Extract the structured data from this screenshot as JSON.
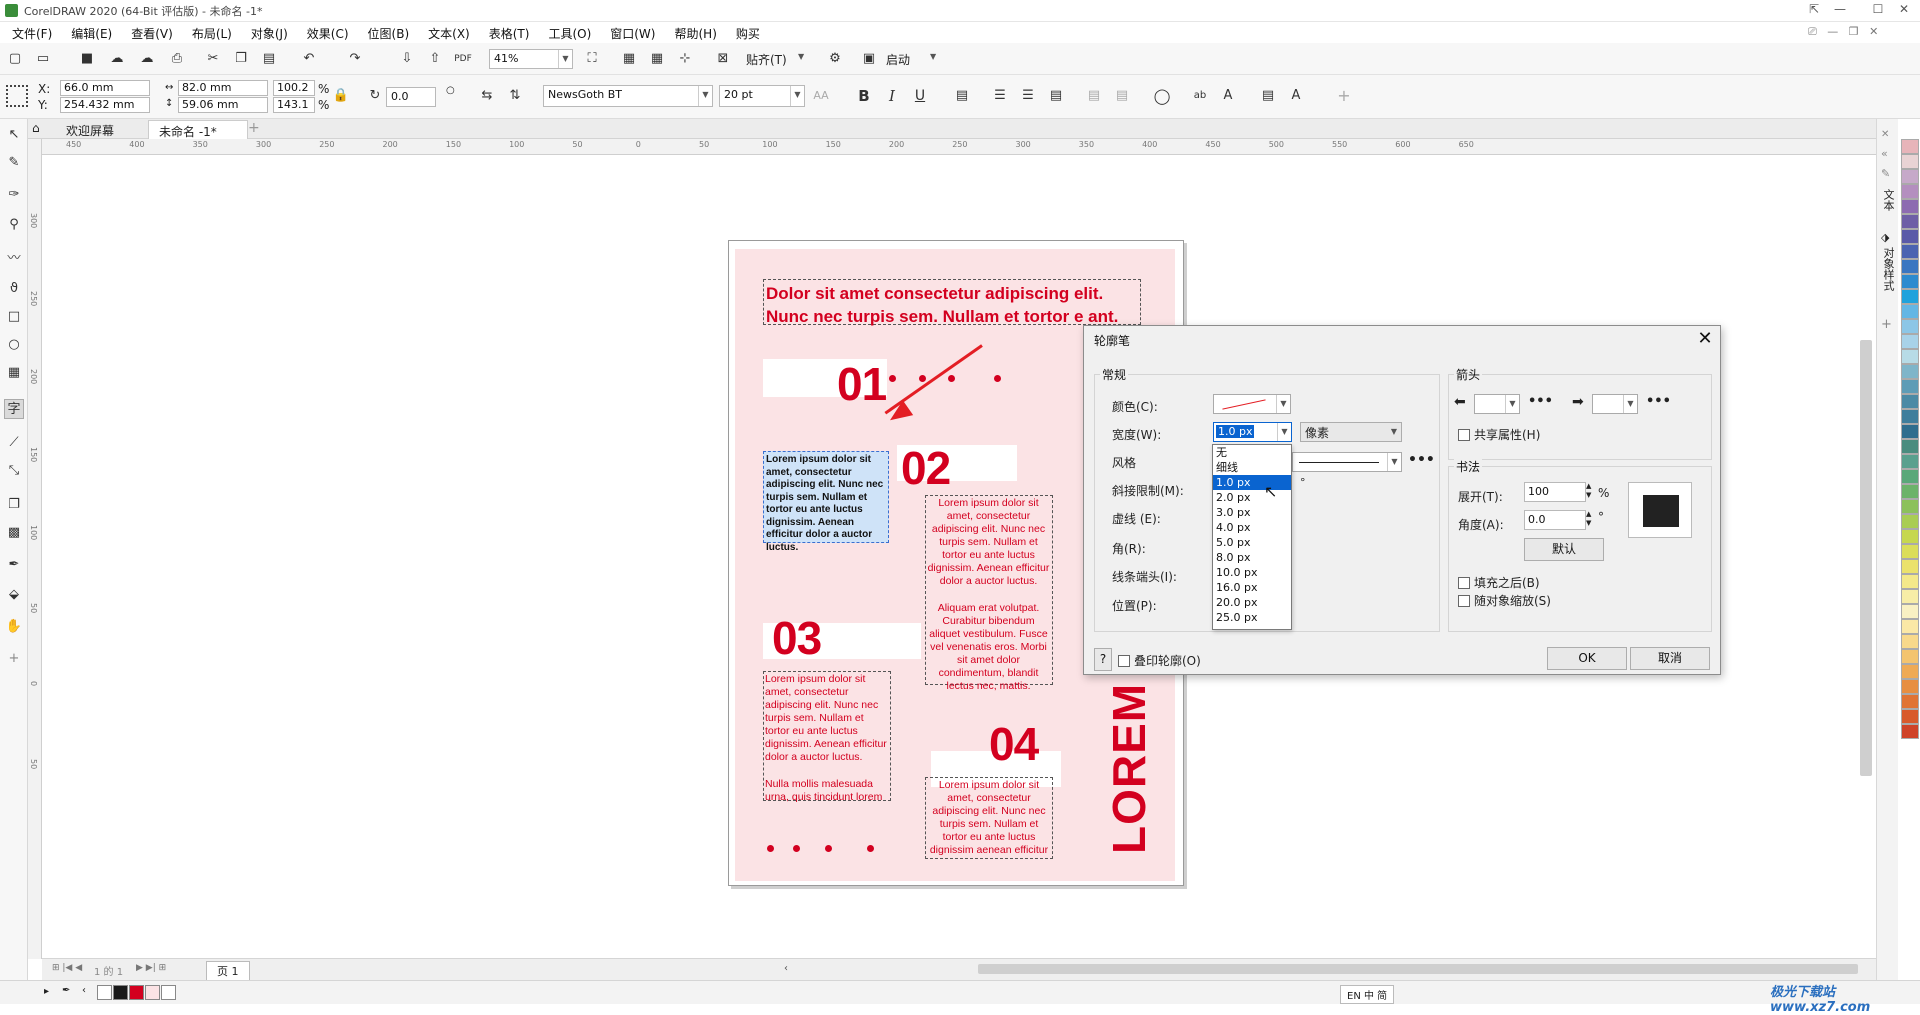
{
  "window": {
    "title": "CorelDRAW 2020 (64-Bit 评估版) - 未命名 -1*"
  },
  "menu": [
    "文件(F)",
    "编辑(E)",
    "查看(V)",
    "布局(L)",
    "对象(J)",
    "效果(C)",
    "位图(B)",
    "文本(X)",
    "表格(T)",
    "工具(O)",
    "窗口(W)",
    "帮助(H)",
    "购买"
  ],
  "toolbar": {
    "zoom": "41%",
    "snap": "贴齐(T)",
    "launch": "启动"
  },
  "props": {
    "x_label": "X:",
    "x": "66.0 mm",
    "y_label": "Y:",
    "y": "254.432 mm",
    "w": "82.0 mm",
    "h": "59.06 mm",
    "sx": "100.2",
    "sy": "143.1",
    "pct": "%",
    "rotation": "0.0",
    "font": "NewsGoth BT",
    "size": "20 pt"
  },
  "tabs": {
    "welcome": "欢迎屏幕",
    "doc": "未命名 -1*"
  },
  "ruler_top": [
    "450",
    "400",
    "350",
    "300",
    "250",
    "200",
    "150",
    "100",
    "50",
    "0",
    "50",
    "100",
    "150",
    "200",
    "250",
    "300",
    "350",
    "400",
    "450",
    "500",
    "550",
    "600",
    "650"
  ],
  "ruler_left": [
    "300",
    "250",
    "200",
    "150",
    "100",
    "50",
    "0",
    "50"
  ],
  "page": {
    "heading": "Dolor sit amet consectetur adipiscing elit. Nunc nec turpis sem. Nullam et tortor e ant.",
    "n1": "01",
    "n2": "02",
    "n3": "03",
    "n4": "04",
    "sel_text": "Lorem ipsum dolor sit amet, consectetur adipiscing elit. Nunc nec turpis sem. Nullam et tortor eu ante luctus dignissim. Aenean efficitur dolor a auctor luctus.",
    "t2a": "Lorem ipsum dolor sit amet, consectetur adipiscing elit. Nunc nec turpis sem. Nullam et tortor eu ante luctus dignissim. Aenean efficitur dolor a auctor luctus.",
    "t2b": "Aliquam erat volutpat. Curabitur bibendum aliquet vestibulum. Fusce vel venenatis eros. Morbi sit amet dolor condimentum, blandit lectus nec, mattis.",
    "t3a": "Lorem ipsum dolor sit amet, consectetur adipiscing elit. Nunc nec turpis sem. Nullam et tortor eu ante luctus dignissim. Aenean efficitur dolor a auctor luctus.",
    "t3b": "Nulla mollis malesuada urna, quis tincidunt lorem",
    "t4": "Lorem ipsum dolor sit amet, consectetur adipiscing elit. Nunc nec turpis sem. Nullam et tortor eu ante luctus dignissim aenean efficitur",
    "vertical": "LOREM"
  },
  "dialog": {
    "title": "轮廓笔",
    "general": "常规",
    "color": "颜色(C):",
    "width": "宽度(W):",
    "width_value": "1.0 px",
    "unit": "像素",
    "style": "风格",
    "miter": "斜接限制(M):",
    "dash": "虚线 (E):",
    "corner": "角(R):",
    "cap": "线条端头(I):",
    "position": "位置(P):",
    "arrows": "箭头",
    "share": "共享属性(H)",
    "calligraphy": "书法",
    "stretch": "展开(T):",
    "stretch_val": "100",
    "angle": "角度(A):",
    "angle_val": "0.0",
    "default": "默认",
    "fill_behind": "填充之后(B)",
    "scale": "随对象缩放(S)",
    "overprint": "叠印轮廓(O)",
    "help": "?",
    "ok": "OK",
    "cancel": "取消",
    "options": [
      "无",
      "细线",
      "1.0 px",
      "2.0 px",
      "3.0 px",
      "4.0 px",
      "5.0 px",
      "8.0 px",
      "10.0 px",
      "16.0 px",
      "20.0 px",
      "25.0 px"
    ],
    "selected": "1.0 px"
  },
  "status": {
    "page": "页 1",
    "pages": "1 的 1",
    "lang": "EN 中 简"
  },
  "dock": {
    "text": "文本",
    "objstyle": "对象样式"
  },
  "watermark": "极光下载站 www.xz7.com",
  "colors": {
    "accent": "#d3001f",
    "pagefill": "#fbe3e5",
    "select": "#0a64d0",
    "annotation": "#e31e24"
  },
  "palette": [
    "#e7b4b9",
    "#e9d3d4",
    "#c6a9c9",
    "#b48fbf",
    "#8d6bb1",
    "#6e5fa6",
    "#5a5aa8",
    "#4b64b1",
    "#3a76c1",
    "#2d8bcf",
    "#1fa2dc",
    "#64b6e4",
    "#8cc6e6",
    "#a8d2e8",
    "#b7dbe6",
    "#7fb5c9",
    "#5e9cb6",
    "#4b8aa5",
    "#3f7e9c",
    "#2f6e8e",
    "#4a8c7f",
    "#59a08e",
    "#5aa879",
    "#6cb36a",
    "#8cc15b",
    "#a9cd53",
    "#c6d74f",
    "#dbde5a",
    "#ebe26c",
    "#f4e98a",
    "#f7eda7",
    "#f9f1c3",
    "#fbe8a6",
    "#f8d98b",
    "#f3c46f",
    "#eeaa55",
    "#e78f41",
    "#e07434",
    "#d85a2c",
    "#cf4328"
  ]
}
